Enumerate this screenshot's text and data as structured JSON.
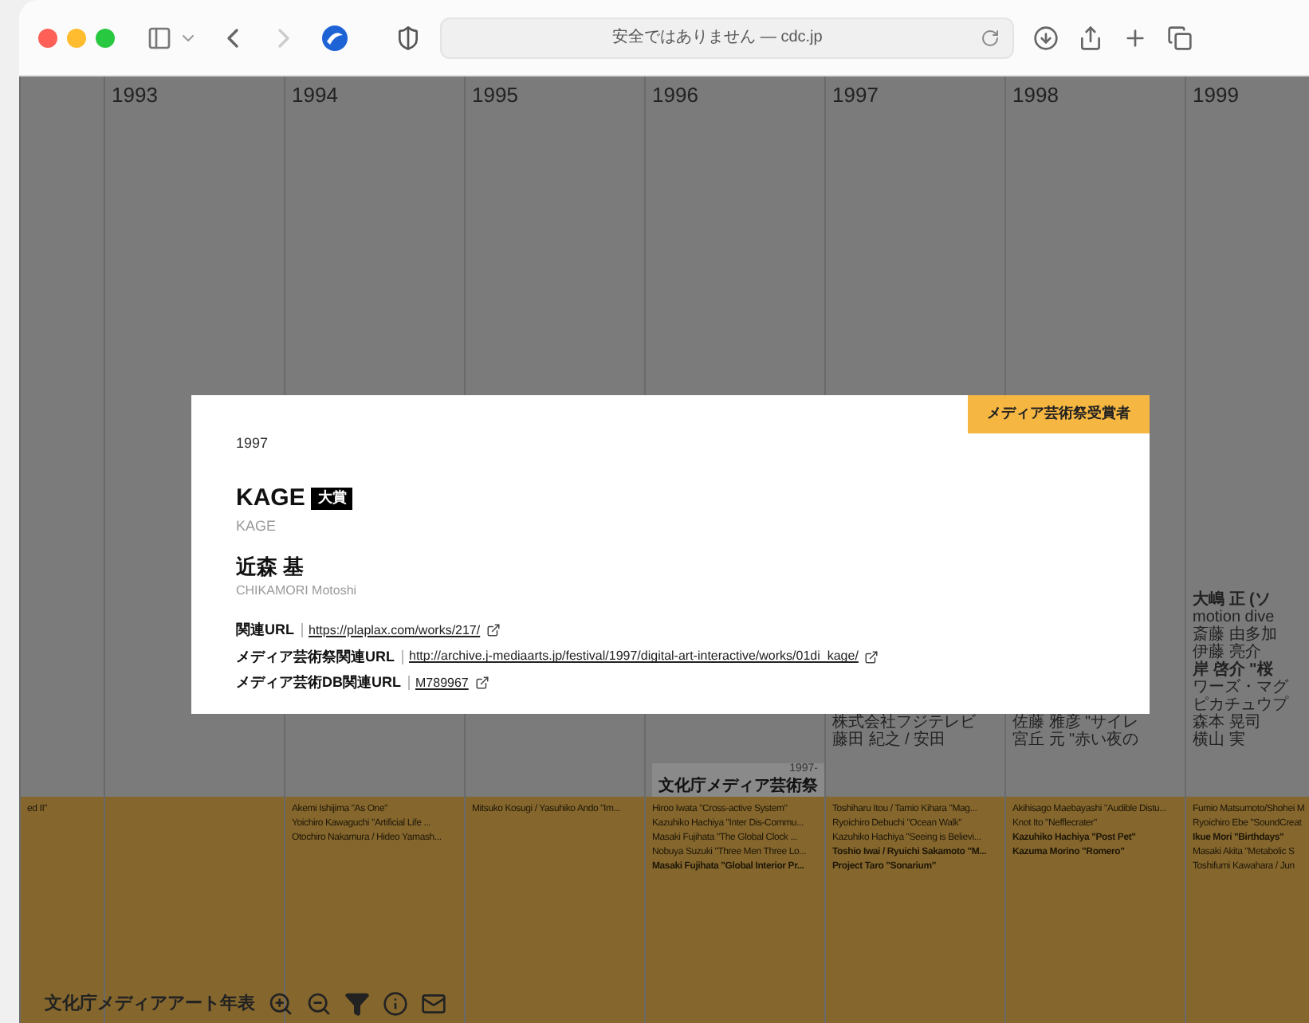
{
  "browser": {
    "address": "安全ではありません — cdc.jp",
    "forward_disabled": true
  },
  "timeline": {
    "columns": [
      {
        "lower": [
          {
            "text": "ed II\"",
            "bold": false
          }
        ]
      },
      {
        "year": "1993"
      },
      {
        "year": "1994",
        "lower": [
          {
            "text": "Akemi Ishijima \"As One\"",
            "bold": false
          },
          {
            "text": "Yoichiro Kawaguchi \"Artificial Life ...",
            "bold": false
          },
          {
            "text": "Otochiro Nakamura / Hideo Yamash...",
            "bold": false
          }
        ]
      },
      {
        "year": "1995",
        "lower": [
          {
            "text": "Mitsuko Kosugi / Yasuhiko Ando \"Im...",
            "bold": false
          }
        ]
      },
      {
        "year": "1996",
        "marker": {
          "since": "1997-",
          "title": "文化庁メディア芸術祭"
        },
        "lower": [
          {
            "text": "Hiroo Iwata \"Cross-active System\"",
            "bold": false
          },
          {
            "text": "Kazuhiko Hachiya \"Inter Dis-Commu...",
            "bold": false
          },
          {
            "text": "Masaki Fujihata \"The Global Clock ...",
            "bold": false
          },
          {
            "text": "Nobuya Suzuki \"Three Men Three Lo...",
            "bold": false
          },
          {
            "text": "Masaki Fujihata \"Global Interior Pr...",
            "bold": true
          }
        ]
      },
      {
        "year": "1997",
        "upper": [
          {
            "text": "株式会社フジテレビ",
            "bold": false
          },
          {
            "text": "藤田 紀之 / 安田",
            "bold": false
          }
        ],
        "lower": [
          {
            "text": "Toshiharu Itou / Tamio Kihara \"Mag...",
            "bold": false
          },
          {
            "text": "Ryoichiro Debuchi \"Ocean Walk\"",
            "bold": false
          },
          {
            "text": "Kazuhiko Hachiya \"Seeing is Believi...",
            "bold": false
          },
          {
            "text": "Toshio Iwai / Ryuichi Sakamoto \"M...",
            "bold": true
          },
          {
            "text": "Project Taro \"Sonarium\"",
            "bold": true
          }
        ]
      },
      {
        "year": "1998",
        "upper": [
          {
            "text": "佐藤 雅彦 \"サイレ",
            "bold": false
          },
          {
            "text": "宮丘 元 \"赤い夜の",
            "bold": false
          }
        ],
        "lower": [
          {
            "text": "Akihisago Maebayashi \"Audible Distu...",
            "bold": false
          },
          {
            "text": "Knot Ito \"Nefflecrater\"",
            "bold": false
          },
          {
            "text": "Kazuhiko Hachiya \"Post Pet\"",
            "bold": true
          },
          {
            "text": "Kazuma Morino \"Romero\"",
            "bold": true
          }
        ]
      },
      {
        "year": "1999",
        "upper": [
          {
            "text": "大嶋 正 (ソ",
            "bold": true
          },
          {
            "text": "motion dive",
            "bold": false
          },
          {
            "text": "斎藤 由多加",
            "bold": false
          },
          {
            "text": "伊藤 亮介",
            "bold": false
          },
          {
            "text": "岸 啓介 \"桜",
            "bold": true
          },
          {
            "text": "ワーズ・マグ",
            "bold": false
          },
          {
            "text": "ピカチュウプ",
            "bold": false
          },
          {
            "text": "森本 晃司",
            "bold": false
          },
          {
            "text": "横山 実",
            "bold": false
          }
        ],
        "lower": [
          {
            "text": "Fumio Matsumoto/Shohei M",
            "bold": false
          },
          {
            "text": "Ryoichiro Ebe \"SoundCreat",
            "bold": false
          },
          {
            "text": "Ikue Mori \"Birthdays\"",
            "bold": true
          },
          {
            "text": "Masaki Akita \"Metabolic S",
            "bold": false
          },
          {
            "text": "Toshifumi Kawahara / Jun",
            "bold": false
          }
        ]
      }
    ]
  },
  "modal": {
    "badge": "メディア芸術祭受賞者",
    "year": "1997",
    "title": "KAGE",
    "award": "大賞",
    "title_reading": "KAGE",
    "artist": "近森 基",
    "artist_reading": "CHIKAMORI Motoshi",
    "links": [
      {
        "label": "関連URL",
        "url": "https://plaplax.com/works/217/"
      },
      {
        "label": "メディア芸術祭関連URL",
        "url": "http://archive.j-mediaarts.jp/festival/1997/digital-art-interactive/works/01di_kage/"
      },
      {
        "label": "メディア芸術DB関連URL",
        "url": "M789967"
      }
    ]
  },
  "footer": {
    "title": "文化庁メディアアート年表"
  }
}
